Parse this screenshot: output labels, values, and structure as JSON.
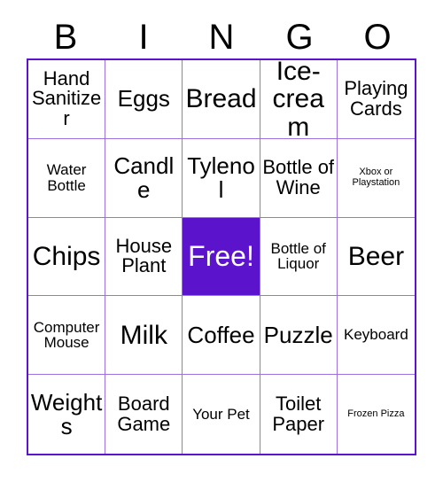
{
  "card": {
    "title": "Bingo Card",
    "header_letters": [
      "B",
      "I",
      "N",
      "G",
      "O"
    ],
    "colors": {
      "outer_border": "#5b13cc",
      "grid_line": "#9b72e0",
      "free_space_background": "#5b13cc",
      "free_space_text": "#ffffff",
      "text": "#000000",
      "background": "#ffffff"
    },
    "free_space_label": "Free!",
    "rows": [
      [
        {
          "label": "Hand Sanitizer",
          "size": "md",
          "free": false
        },
        {
          "label": "Eggs",
          "size": "lg",
          "free": false
        },
        {
          "label": "Bread",
          "size": "xl",
          "free": false
        },
        {
          "label": "Ice-cream",
          "size": "xl",
          "free": false
        },
        {
          "label": "Playing Cards",
          "size": "md",
          "free": false
        }
      ],
      [
        {
          "label": "Water Bottle",
          "size": "sm",
          "free": false
        },
        {
          "label": "Candle",
          "size": "lg",
          "free": false
        },
        {
          "label": "Tylenol",
          "size": "lg",
          "free": false
        },
        {
          "label": "Bottle of Wine",
          "size": "md",
          "free": false
        },
        {
          "label": "Xbox or Playstation",
          "size": "xs",
          "free": false
        }
      ],
      [
        {
          "label": "Chips",
          "size": "xl",
          "free": false
        },
        {
          "label": "House Plant",
          "size": "md",
          "free": false
        },
        {
          "label": "Free!",
          "size": "xl",
          "free": true
        },
        {
          "label": "Bottle of Liquor",
          "size": "sm",
          "free": false
        },
        {
          "label": "Beer",
          "size": "xl",
          "free": false
        }
      ],
      [
        {
          "label": "Computer Mouse",
          "size": "sm",
          "free": false
        },
        {
          "label": "Milk",
          "size": "xl",
          "free": false
        },
        {
          "label": "Coffee",
          "size": "lg",
          "free": false
        },
        {
          "label": "Puzzle",
          "size": "lg",
          "free": false
        },
        {
          "label": "Keyboard",
          "size": "sm",
          "free": false
        }
      ],
      [
        {
          "label": "Weights",
          "size": "lg",
          "free": false
        },
        {
          "label": "Board Game",
          "size": "md",
          "free": false
        },
        {
          "label": "Your Pet",
          "size": "sm",
          "free": false
        },
        {
          "label": "Toilet Paper",
          "size": "md",
          "free": false
        },
        {
          "label": "Frozen Pizza",
          "size": "xs",
          "free": false
        }
      ]
    ]
  }
}
